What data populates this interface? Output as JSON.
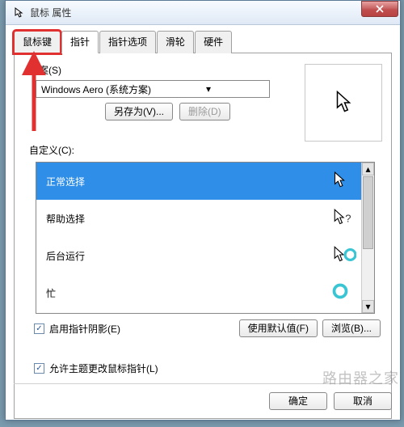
{
  "window": {
    "title": "鼠标 属性"
  },
  "tabs": [
    {
      "label": "鼠标键",
      "active": false,
      "highlighted": true
    },
    {
      "label": "指针",
      "active": true
    },
    {
      "label": "指针选项",
      "active": false
    },
    {
      "label": "滑轮",
      "active": false
    },
    {
      "label": "硬件",
      "active": false
    }
  ],
  "scheme": {
    "label": "方案(S)",
    "current": "Windows Aero (系统方案)",
    "save_as": "另存为(V)...",
    "delete": "删除(D)"
  },
  "customize": {
    "label": "自定义(C):",
    "items": [
      {
        "label": "正常选择",
        "icon": "cursor-arrow",
        "selected": true
      },
      {
        "label": "帮助选择",
        "icon": "cursor-help",
        "selected": false
      },
      {
        "label": "后台运行",
        "icon": "cursor-busy-bg",
        "selected": false
      },
      {
        "label": "忙",
        "icon": "cursor-busy",
        "selected": false
      }
    ]
  },
  "checkboxes": {
    "shadow": {
      "label": "启用指针阴影(E)",
      "checked": true
    },
    "theme": {
      "label": "允许主题更改鼠标指针(L)",
      "checked": true
    }
  },
  "buttons": {
    "defaults": "使用默认值(F)",
    "browse": "浏览(B)...",
    "ok": "确定",
    "cancel": "取消"
  },
  "watermark": "路由器之家"
}
